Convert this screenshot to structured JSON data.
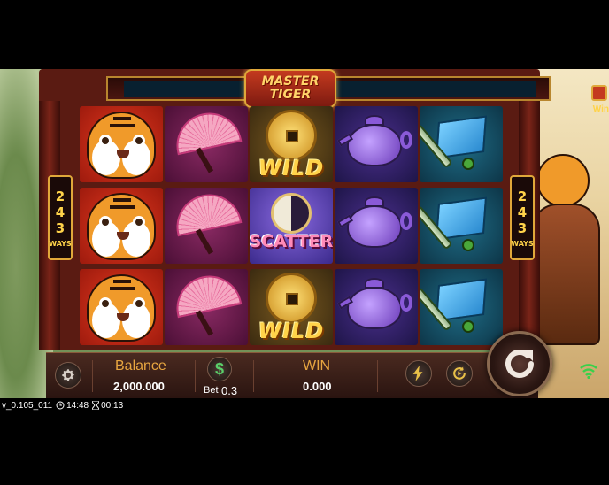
{
  "game": {
    "logo_line1": "MASTER",
    "logo_line2": "TIGER",
    "ways_number_digits": [
      "2",
      "4",
      "3"
    ],
    "ways_label": "WAYS",
    "win_badge_label": "Win"
  },
  "reels": [
    [
      "tiger",
      "tiger",
      "tiger"
    ],
    [
      "fan",
      "fan",
      "fan"
    ],
    [
      "wild-coin",
      "yinyang-scatter",
      "wild-coin"
    ],
    [
      "teapot",
      "teapot",
      "teapot"
    ],
    [
      "scroll",
      "scroll",
      "scroll"
    ]
  ],
  "symbols": {
    "wild_text": "WILD",
    "scatter_text": "SCATTER"
  },
  "bottom_bar": {
    "balance_label": "Balance",
    "balance_value": "2,000.000",
    "bet_label": "Bet",
    "bet_value": "0.3",
    "win_label": "WIN",
    "win_value": "0.000",
    "icons": {
      "settings": "gear-icon",
      "bet": "dollar-icon",
      "turbo": "lightning-icon",
      "autoplay": "auto-spin-icon",
      "spin": "spin-arrow-icon",
      "signal": "wifi-icon"
    }
  },
  "footer": {
    "version": "v_0.105_011",
    "clock": "14:48",
    "timer": "00:13"
  },
  "colors": {
    "accent_gold": "#e8a640",
    "frame_red": "#5a1b12",
    "bar_dark": "#2a1410"
  }
}
